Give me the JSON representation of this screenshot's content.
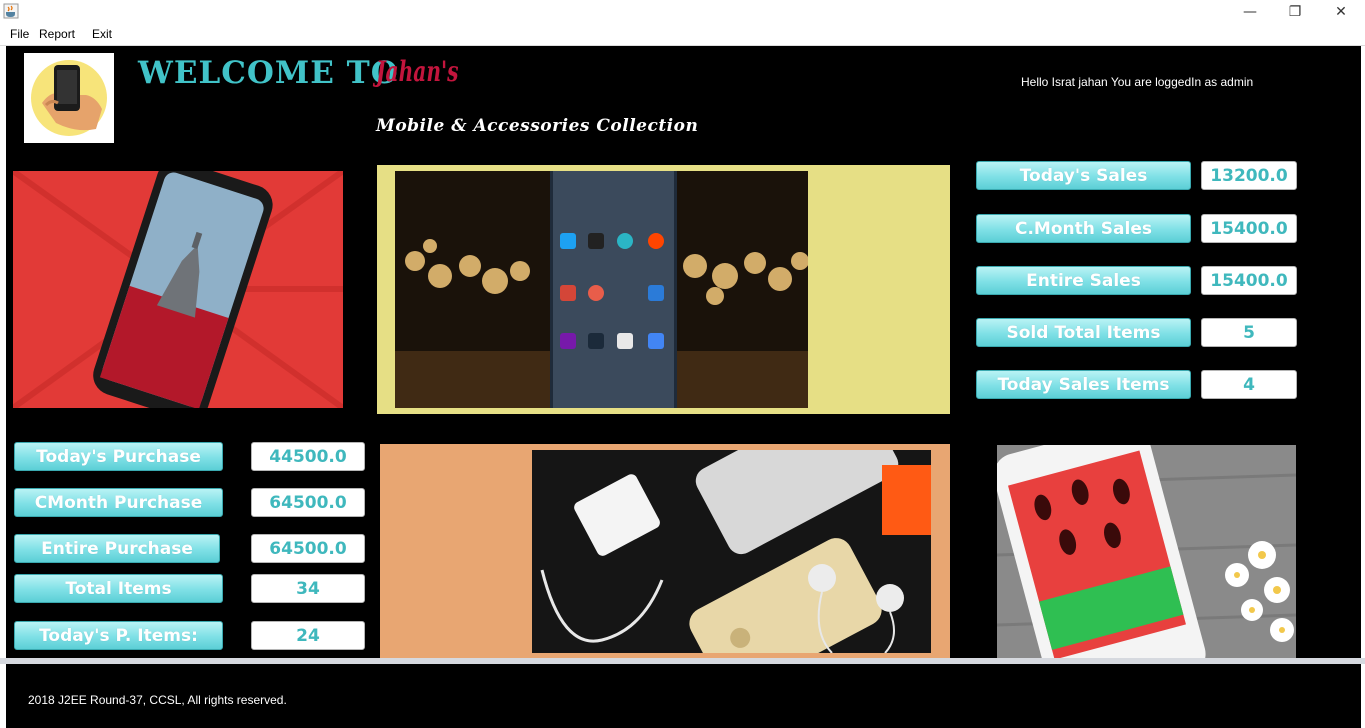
{
  "window": {
    "controls": {
      "minimize": "—",
      "restore": "❐",
      "close": "✕"
    },
    "icon": "java-coffee-icon"
  },
  "menu": [
    "File",
    "Report",
    "Exit"
  ],
  "header": {
    "welcome": "WELCOME TO",
    "brand": "Jahan's",
    "tagline": "Mobile & Accessories Collection",
    "greeting": "Hello Israt jahan You are loggedIn as admin"
  },
  "sales_stats": [
    {
      "label": "Today's Sales",
      "value": "13200.0"
    },
    {
      "label": "C.Month Sales",
      "value": "15400.0"
    },
    {
      "label": "Entire Sales",
      "value": "15400.0"
    },
    {
      "label": "Sold Total Items",
      "value": "5"
    },
    {
      "label": "Today Sales Items",
      "value": "4"
    }
  ],
  "purchase_stats": [
    {
      "label": "Today's Purchase",
      "value": "44500.0"
    },
    {
      "label": "CMonth Purchase",
      "value": "64500.0"
    },
    {
      "label": "Entire Purchase",
      "value": "64500.0"
    },
    {
      "label": "Total Items",
      "value": "34"
    },
    {
      "label": "Today's P. Items:",
      "value": "24"
    }
  ],
  "footer": {
    "copyright": "2018 J2EE Round-37, CCSL, All rights reserved."
  },
  "colors": {
    "accent_cyan": "#41c3c8",
    "brand_red": "#c3153d",
    "panel_yellow": "#e6df85",
    "panel_orange": "#e8a672"
  }
}
